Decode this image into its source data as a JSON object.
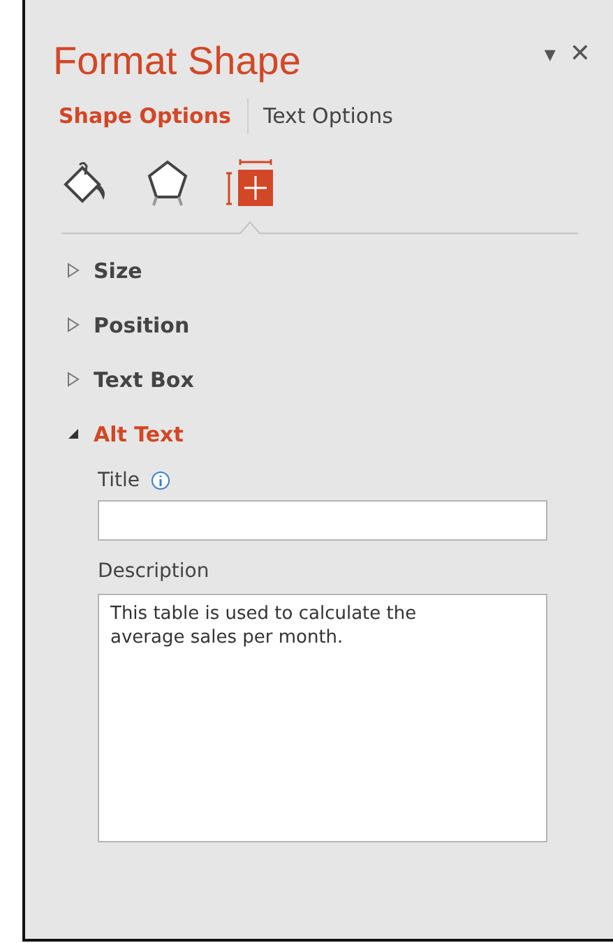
{
  "pane": {
    "title": "Format Shape",
    "menu_icon": "▾",
    "close_icon": "✕"
  },
  "tabs": [
    {
      "label": "Shape Options",
      "selected": true
    },
    {
      "label": "Text Options",
      "selected": false
    }
  ],
  "icon_tabs": [
    {
      "kind": "fill",
      "selected": false
    },
    {
      "kind": "shape",
      "selected": false
    },
    {
      "kind": "size",
      "selected": true
    }
  ],
  "sections": [
    {
      "label": "Size",
      "expanded": false
    },
    {
      "label": "Position",
      "expanded": false
    },
    {
      "label": "Text Box",
      "expanded": false
    },
    {
      "label": "Alt Text",
      "expanded": true
    }
  ],
  "alt_text": {
    "title_label": "Title",
    "description_label": "Description",
    "description_value": "This table is used to calculate the average sales per month."
  }
}
